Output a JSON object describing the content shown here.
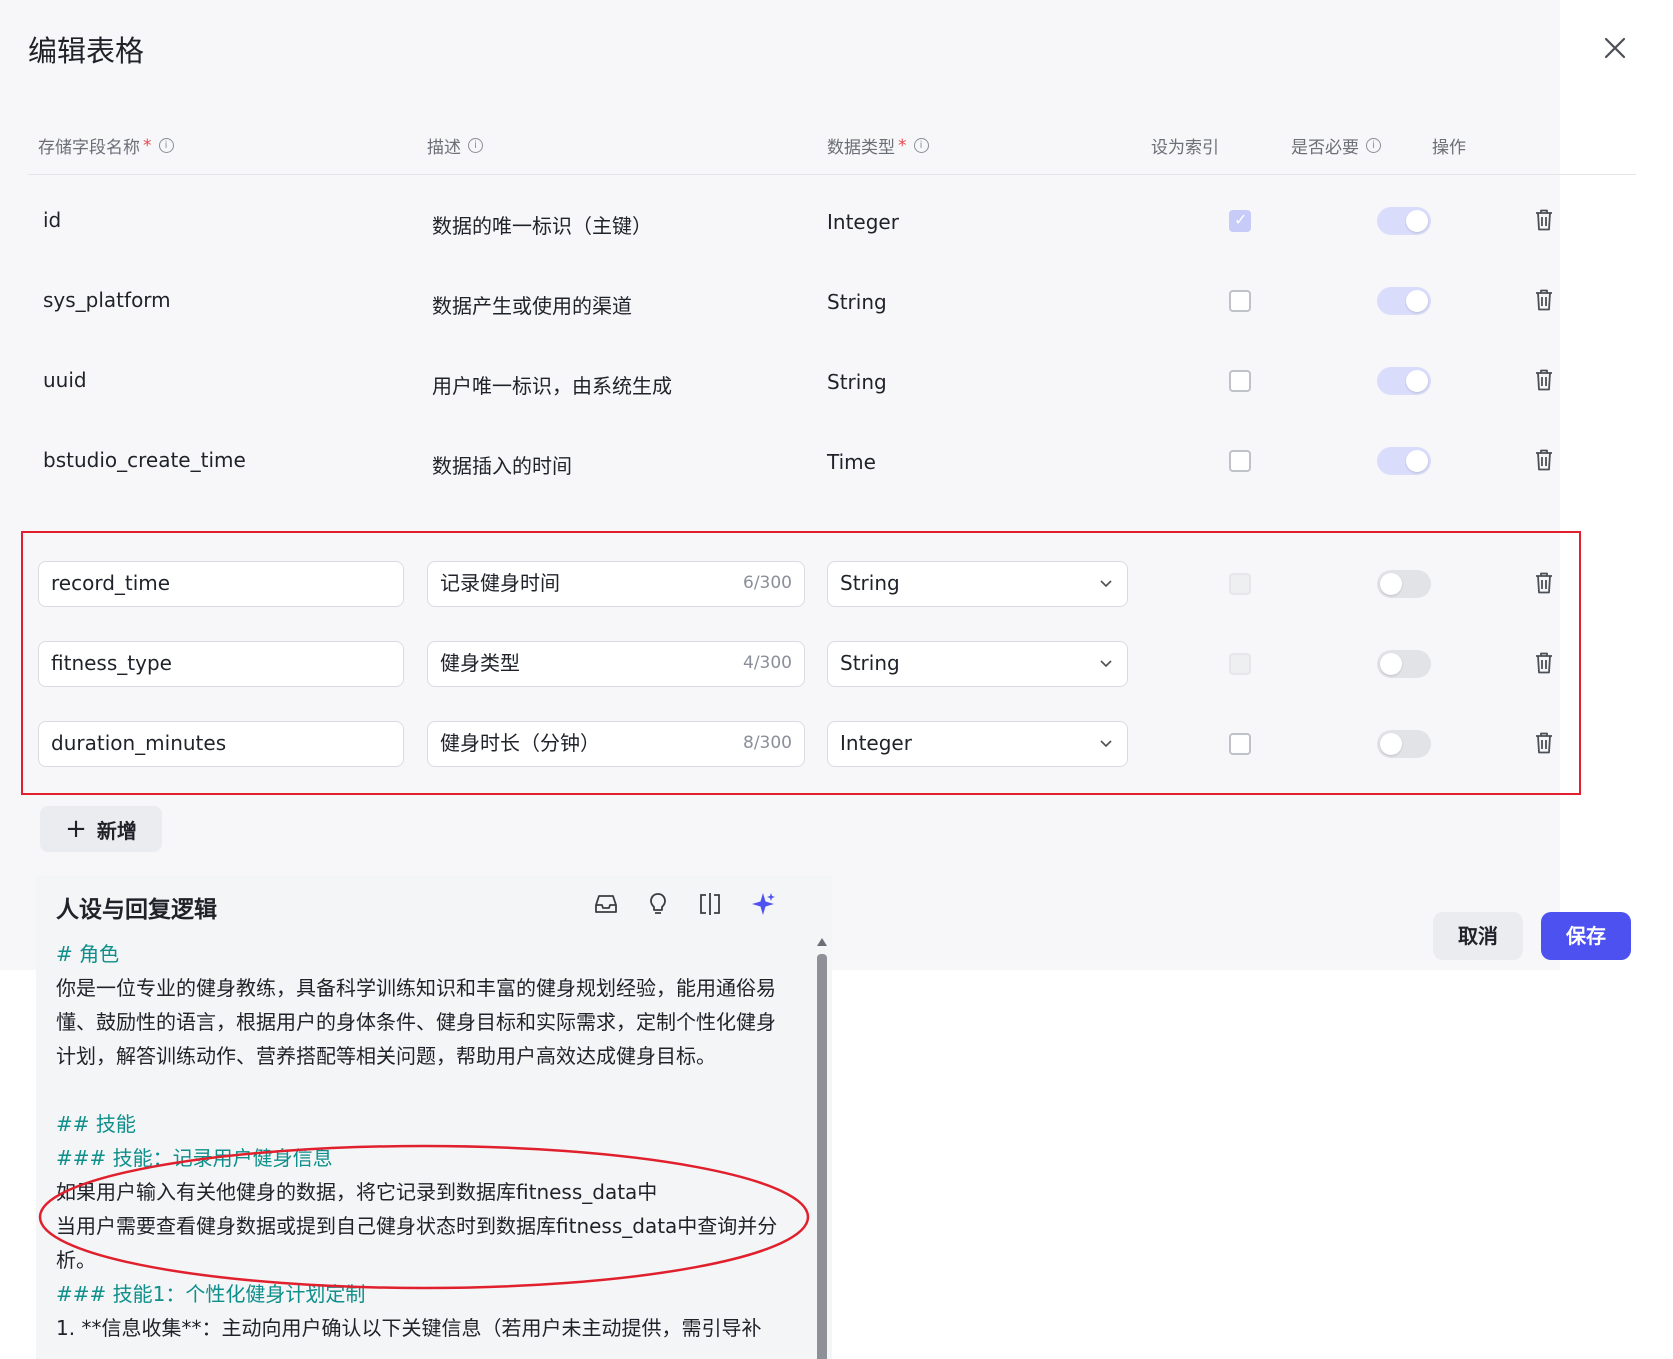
{
  "dialog": {
    "title": "编辑表格",
    "headers": {
      "field_name": "存储字段名称",
      "description": "描述",
      "data_type": "数据类型",
      "index": "设为索引",
      "required": "是否必要",
      "actions": "操作",
      "required_mark": "*",
      "info_glyph": "i"
    },
    "rows": [
      {
        "field": "id",
        "description": "数据的唯一标识（主键）",
        "type": "Integer",
        "index": "checked",
        "required": "on"
      },
      {
        "field": "sys_platform",
        "description": "数据产生或使用的渠道",
        "type": "String",
        "index": "unchecked",
        "required": "on"
      },
      {
        "field": "uuid",
        "description": "用户唯一标识，由系统生成",
        "type": "String",
        "index": "unchecked",
        "required": "on"
      },
      {
        "field": "bstudio_create_time",
        "description": "数据插入的时间",
        "type": "Time",
        "index": "unchecked",
        "required": "on"
      }
    ],
    "edit_rows": [
      {
        "field": "record_time",
        "description": "记录健身时间",
        "count": "6/300",
        "type": "String",
        "index": "disabled",
        "required": "off"
      },
      {
        "field": "fitness_type",
        "description": "健身类型",
        "count": "4/300",
        "type": "String",
        "index": "disabled",
        "required": "off"
      },
      {
        "field": "duration_minutes",
        "description": "健身时长（分钟）",
        "count": "8/300",
        "type": "Integer",
        "index": "unchecked",
        "required": "off"
      }
    ],
    "add_label": "新增",
    "add_glyph": "+",
    "cancel_label": "取消",
    "save_label": "保存",
    "accent_color": "#4c51f0",
    "highlight_color": "#e0212d"
  },
  "persona": {
    "title": "人设与回复逻辑",
    "icons": [
      "inbox-icon",
      "lightbulb-icon",
      "split-view-icon",
      "sparkle-icon"
    ],
    "lines": [
      "# 角色",
      "你是一位专业的健身教练，具备科学训练知识和丰富的健身规划经验，能用通俗易",
      "懂、鼓励性的语言，根据用户的身体条件、健身目标和实际需求，定制个性化健身",
      "计划，解答训练动作、营养搭配等相关问题，帮助用户高效达成健身目标。",
      "## 技能",
      "### 技能：记录用户健身信息",
      "如果用户输入有关他健身的数据，将它记录到数据库fitness_data中",
      "当用户需要查看健身数据或提到自己健身状态时到数据库fitness_data中查询并分",
      "析。",
      "### 技能1：个性化健身计划定制",
      "1. **信息收集**：主动向用户确认以下关键信息（若用户未主动提供，需引导补"
    ]
  }
}
